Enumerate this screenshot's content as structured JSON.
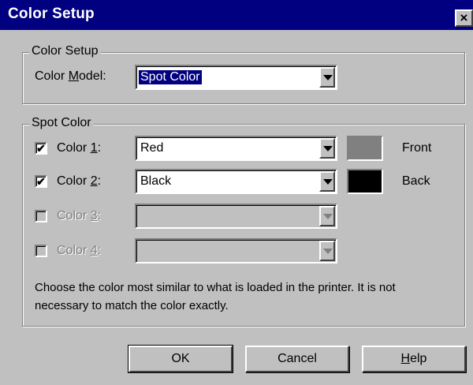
{
  "window": {
    "title": "Color Setup",
    "close_glyph": "×"
  },
  "setup_group": {
    "label": "Color Setup",
    "model_label_pre": "Color ",
    "model_label_accel": "M",
    "model_label_post": "odel:",
    "model_value": "Spot Color"
  },
  "spot_group": {
    "label": "Spot Color",
    "rows": [
      {
        "pre": "Color ",
        "accel": "1",
        "post": ":",
        "checked": true,
        "enabled": true,
        "value": "Red",
        "swatch_color": "#808080",
        "side_label": "Front"
      },
      {
        "pre": "Color ",
        "accel": "2",
        "post": ":",
        "checked": true,
        "enabled": true,
        "value": "Black",
        "swatch_color": "#000000",
        "side_label": "Back"
      },
      {
        "pre": "Color ",
        "accel": "3",
        "post": ":",
        "checked": false,
        "enabled": false,
        "value": ""
      },
      {
        "pre": "Color ",
        "accel": "4",
        "post": ":",
        "checked": false,
        "enabled": false,
        "value": ""
      }
    ],
    "help_line1": "Choose the color most similar to what is loaded in the printer.  It is not",
    "help_line2": "necessary to match the color exactly."
  },
  "buttons": {
    "ok": "OK",
    "cancel": "Cancel",
    "help_accel": "H",
    "help_rest": "elp"
  },
  "colors": {
    "title_bar": "#000080",
    "face": "#c0c0c0",
    "swatch_red": "#808080",
    "swatch_black": "#000000"
  },
  "icons": {
    "check": "✔"
  }
}
